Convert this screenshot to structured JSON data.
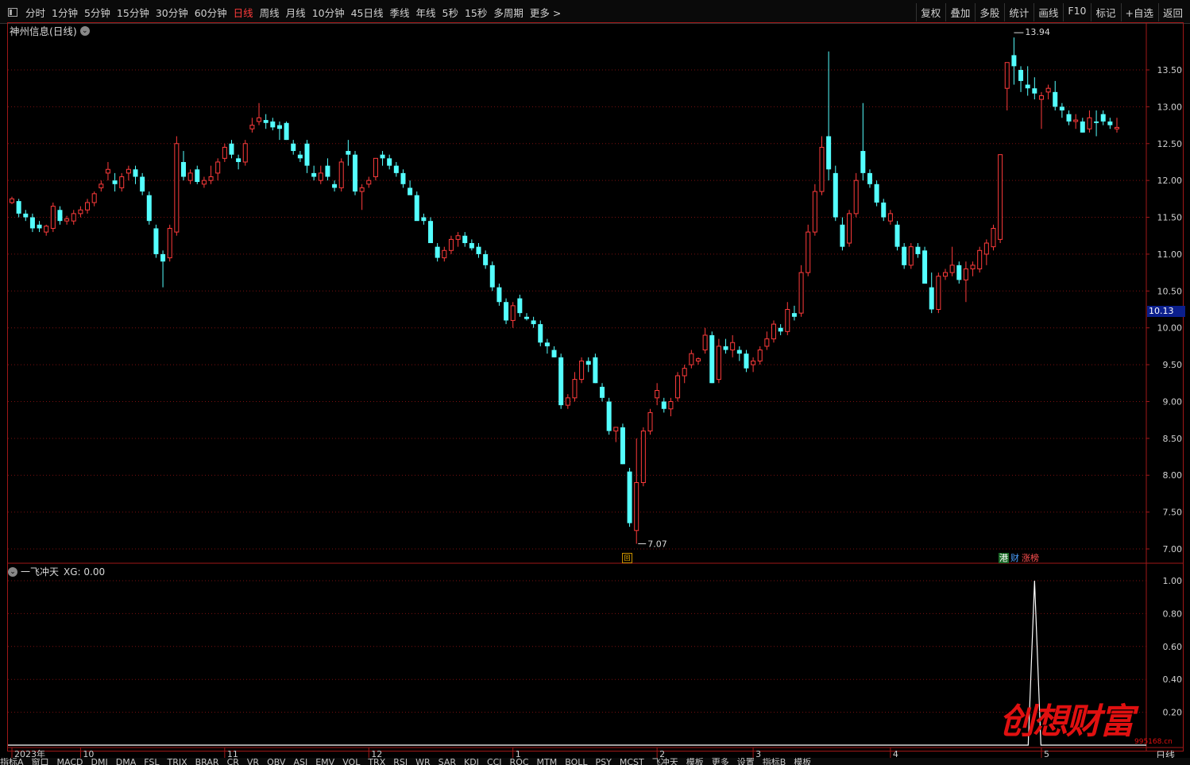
{
  "toolbar": {
    "periods": [
      "分时",
      "1分钟",
      "5分钟",
      "15分钟",
      "30分钟",
      "60分钟",
      "日线",
      "周线",
      "月线",
      "10分钟",
      "45日线",
      "季线",
      "年线",
      "5秒",
      "15秒",
      "多周期",
      "更多 >"
    ],
    "active_period": "日线",
    "right_buttons": [
      "复权",
      "叠加",
      "多股",
      "统计",
      "画线",
      "F10",
      "标记",
      "+自选",
      "返回"
    ]
  },
  "chart": {
    "title": "神州信息(日线)",
    "high_label": "13.94",
    "low_label": "7.07",
    "current_price": "10.13",
    "price_axis": [
      "13.50",
      "13.00",
      "12.50",
      "12.00",
      "11.50",
      "11.00",
      "10.50",
      "10.00",
      "9.50",
      "9.00",
      "8.50",
      "8.00",
      "7.50",
      "7.00"
    ],
    "date_axis": [
      "2023年",
      "10",
      "11",
      "12",
      "1",
      "2",
      "3",
      "4",
      "5"
    ],
    "tags": {
      "hk": "港",
      "cai": "财",
      "zhangbang": "涨榜",
      "event": "回"
    }
  },
  "indicator": {
    "name": "一飞冲天",
    "value_label": "XG: 0.00",
    "axis": [
      "1.00",
      "0.80",
      "0.60",
      "0.40",
      "0.20"
    ]
  },
  "colors": {
    "up": "#ff3b3b",
    "down": "#54ffff",
    "grid": "#7a1010",
    "frame": "#a01818",
    "signal": "#ffffff"
  },
  "bottom_tabs": [
    "指标A",
    "窗口",
    "MACD",
    "DMI",
    "DMA",
    "FSL",
    "TRIX",
    "BRAR",
    "CR",
    "VR",
    "OBV",
    "ASI",
    "EMV",
    "VOL",
    "TRX",
    "RSI",
    "WR",
    "SAR",
    "KDJ",
    "CCI",
    "ROC",
    "MTM",
    "BOLL",
    "PSY",
    "MCST",
    "飞冲天",
    "模板",
    "更多",
    "设置",
    "指标B",
    "模板"
  ],
  "timeframe_corner": "日线",
  "watermark": {
    "text": "创想财富",
    "url": "995168.cn"
  },
  "chart_data": {
    "type": "candlestick",
    "ylim": [
      6.95,
      14.1
    ],
    "candles": [
      [
        11.7,
        11.78,
        11.68,
        11.75
      ],
      [
        11.72,
        11.75,
        11.5,
        11.55
      ],
      [
        11.55,
        11.6,
        11.45,
        11.5
      ],
      [
        11.5,
        11.55,
        11.3,
        11.35
      ],
      [
        11.4,
        11.45,
        11.3,
        11.35
      ],
      [
        11.3,
        11.4,
        11.25,
        11.38
      ],
      [
        11.35,
        11.7,
        11.3,
        11.65
      ],
      [
        11.6,
        11.65,
        11.4,
        11.45
      ],
      [
        11.45,
        11.52,
        11.4,
        11.48
      ],
      [
        11.45,
        11.6,
        11.4,
        11.55
      ],
      [
        11.55,
        11.65,
        11.5,
        11.6
      ],
      [
        11.6,
        11.75,
        11.55,
        11.7
      ],
      [
        11.7,
        11.85,
        11.65,
        11.82
      ],
      [
        11.9,
        12.0,
        11.85,
        11.95
      ],
      [
        12.1,
        12.25,
        12.0,
        12.15
      ],
      [
        12.0,
        12.1,
        11.85,
        11.95
      ],
      [
        11.9,
        12.1,
        11.85,
        12.05
      ],
      [
        12.1,
        12.2,
        12.0,
        12.15
      ],
      [
        12.15,
        12.2,
        11.95,
        12.05
      ],
      [
        12.05,
        12.1,
        11.8,
        11.85
      ],
      [
        11.8,
        11.85,
        11.4,
        11.45
      ],
      [
        11.35,
        11.4,
        10.95,
        11.0
      ],
      [
        11.0,
        11.05,
        10.55,
        10.9
      ],
      [
        10.95,
        11.4,
        10.9,
        11.35
      ],
      [
        11.3,
        12.6,
        11.25,
        12.5
      ],
      [
        12.25,
        12.4,
        12.0,
        12.05
      ],
      [
        12.0,
        12.15,
        11.95,
        12.1
      ],
      [
        12.15,
        12.2,
        11.95,
        11.98
      ],
      [
        11.95,
        12.05,
        11.9,
        12.0
      ],
      [
        12.0,
        12.2,
        11.95,
        12.05
      ],
      [
        12.1,
        12.3,
        12.0,
        12.25
      ],
      [
        12.3,
        12.5,
        12.25,
        12.45
      ],
      [
        12.5,
        12.55,
        12.3,
        12.35
      ],
      [
        12.3,
        12.35,
        12.15,
        12.25
      ],
      [
        12.25,
        12.55,
        12.2,
        12.5
      ],
      [
        12.7,
        12.85,
        12.65,
        12.75
      ],
      [
        12.8,
        13.05,
        12.75,
        12.85
      ],
      [
        12.82,
        12.9,
        12.7,
        12.78
      ],
      [
        12.8,
        12.85,
        12.68,
        12.72
      ],
      [
        12.75,
        12.8,
        12.55,
        12.7
      ],
      [
        12.78,
        12.8,
        12.55,
        12.55
      ],
      [
        12.5,
        12.55,
        12.35,
        12.4
      ],
      [
        12.35,
        12.4,
        12.25,
        12.3
      ],
      [
        12.5,
        12.55,
        12.1,
        12.2
      ],
      [
        12.1,
        12.2,
        12.0,
        12.05
      ],
      [
        12.0,
        12.2,
        11.95,
        12.1
      ],
      [
        12.2,
        12.3,
        12.0,
        12.05
      ],
      [
        11.95,
        12.0,
        11.85,
        11.9
      ],
      [
        11.9,
        12.3,
        11.85,
        12.25
      ],
      [
        12.4,
        12.55,
        12.2,
        12.35
      ],
      [
        12.35,
        12.4,
        11.8,
        11.85
      ],
      [
        11.85,
        11.95,
        11.6,
        11.9
      ],
      [
        11.95,
        12.05,
        11.9,
        12.0
      ],
      [
        12.05,
        12.2,
        12.0,
        12.3
      ],
      [
        12.35,
        12.4,
        12.2,
        12.3
      ],
      [
        12.3,
        12.35,
        12.15,
        12.2
      ],
      [
        12.2,
        12.25,
        12.05,
        12.1
      ],
      [
        12.1,
        12.15,
        11.9,
        11.95
      ],
      [
        11.9,
        12.0,
        11.85,
        11.8
      ],
      [
        11.8,
        11.85,
        11.5,
        11.45
      ],
      [
        11.5,
        11.55,
        11.4,
        11.45
      ],
      [
        11.45,
        11.5,
        11.15,
        11.15
      ],
      [
        11.1,
        11.15,
        10.9,
        10.95
      ],
      [
        10.95,
        11.1,
        10.9,
        11.05
      ],
      [
        11.05,
        11.25,
        11.0,
        11.2
      ],
      [
        11.2,
        11.3,
        11.1,
        11.25
      ],
      [
        11.25,
        11.3,
        11.1,
        11.15
      ],
      [
        11.15,
        11.2,
        11.05,
        11.08
      ],
      [
        11.1,
        11.15,
        10.95,
        11.0
      ],
      [
        11.0,
        11.05,
        10.8,
        10.85
      ],
      [
        10.85,
        10.9,
        10.5,
        10.55
      ],
      [
        10.55,
        10.6,
        10.3,
        10.35
      ],
      [
        10.35,
        10.4,
        10.05,
        10.1
      ],
      [
        10.1,
        10.35,
        10.0,
        10.3
      ],
      [
        10.4,
        10.45,
        10.15,
        10.2
      ],
      [
        10.15,
        10.2,
        10.1,
        10.12
      ],
      [
        10.1,
        10.15,
        10.0,
        10.05
      ],
      [
        10.05,
        10.1,
        9.75,
        9.8
      ],
      [
        9.8,
        9.85,
        9.65,
        9.75
      ],
      [
        9.7,
        9.75,
        9.6,
        9.6
      ],
      [
        9.6,
        9.65,
        8.9,
        8.95
      ],
      [
        8.95,
        9.1,
        8.9,
        9.05
      ],
      [
        9.05,
        9.4,
        9.0,
        9.3
      ],
      [
        9.3,
        9.6,
        9.25,
        9.55
      ],
      [
        9.55,
        9.6,
        9.4,
        9.5
      ],
      [
        9.6,
        9.65,
        9.25,
        9.25
      ],
      [
        9.2,
        9.25,
        9.0,
        9.05
      ],
      [
        9.0,
        9.05,
        8.55,
        8.6
      ],
      [
        8.6,
        8.65,
        8.45,
        8.65
      ],
      [
        8.65,
        8.7,
        8.15,
        8.15
      ],
      [
        8.05,
        8.1,
        7.3,
        7.35
      ],
      [
        7.25,
        8.5,
        7.07,
        7.9
      ],
      [
        7.9,
        8.65,
        7.85,
        8.6
      ],
      [
        8.6,
        8.9,
        8.55,
        8.85
      ],
      [
        9.05,
        9.25,
        8.95,
        9.15
      ],
      [
        9.0,
        9.05,
        8.85,
        8.9
      ],
      [
        8.9,
        9.05,
        8.8,
        9.0
      ],
      [
        9.05,
        9.4,
        9.0,
        9.35
      ],
      [
        9.35,
        9.5,
        9.25,
        9.45
      ],
      [
        9.5,
        9.7,
        9.45,
        9.65
      ],
      [
        9.55,
        9.6,
        9.5,
        9.58
      ],
      [
        9.7,
        10.0,
        9.65,
        9.9
      ],
      [
        9.9,
        9.95,
        9.25,
        9.25
      ],
      [
        9.3,
        9.85,
        9.25,
        9.75
      ],
      [
        9.75,
        9.85,
        9.65,
        9.7
      ],
      [
        9.7,
        9.9,
        9.6,
        9.8
      ],
      [
        9.7,
        9.75,
        9.55,
        9.65
      ],
      [
        9.65,
        9.7,
        9.4,
        9.45
      ],
      [
        9.5,
        9.6,
        9.4,
        9.55
      ],
      [
        9.55,
        9.75,
        9.5,
        9.7
      ],
      [
        9.75,
        9.95,
        9.7,
        9.85
      ],
      [
        9.85,
        10.1,
        9.8,
        10.05
      ],
      [
        10.0,
        10.05,
        9.9,
        9.95
      ],
      [
        9.95,
        10.35,
        9.9,
        10.25
      ],
      [
        10.2,
        10.3,
        10.1,
        10.15
      ],
      [
        10.2,
        10.85,
        10.15,
        10.75
      ],
      [
        10.75,
        11.4,
        10.7,
        11.3
      ],
      [
        11.3,
        11.95,
        11.25,
        11.85
      ],
      [
        11.85,
        12.6,
        11.8,
        12.45
      ],
      [
        12.6,
        13.75,
        12.0,
        12.15
      ],
      [
        12.1,
        12.2,
        11.45,
        11.5
      ],
      [
        11.4,
        11.5,
        11.05,
        11.1
      ],
      [
        11.15,
        11.6,
        11.1,
        11.55
      ],
      [
        11.55,
        12.1,
        11.5,
        12.0
      ],
      [
        12.4,
        13.05,
        12.0,
        12.1
      ],
      [
        12.1,
        12.15,
        11.9,
        11.95
      ],
      [
        11.95,
        12.0,
        11.65,
        11.7
      ],
      [
        11.7,
        11.75,
        11.45,
        11.5
      ],
      [
        11.45,
        11.6,
        11.4,
        11.55
      ],
      [
        11.4,
        11.45,
        11.05,
        11.1
      ],
      [
        11.1,
        11.15,
        10.8,
        10.85
      ],
      [
        10.85,
        11.15,
        10.8,
        11.1
      ],
      [
        11.1,
        11.15,
        10.95,
        11.0
      ],
      [
        11.05,
        11.1,
        10.6,
        10.6
      ],
      [
        10.55,
        10.75,
        10.2,
        10.25
      ],
      [
        10.25,
        10.75,
        10.2,
        10.7
      ],
      [
        10.7,
        10.8,
        10.65,
        10.75
      ],
      [
        10.75,
        11.1,
        10.7,
        10.85
      ],
      [
        10.85,
        10.9,
        10.6,
        10.65
      ],
      [
        10.65,
        10.9,
        10.35,
        10.8
      ],
      [
        10.8,
        10.9,
        10.7,
        10.85
      ],
      [
        10.8,
        11.1,
        10.75,
        11.05
      ],
      [
        11.0,
        11.2,
        10.85,
        11.15
      ],
      [
        11.1,
        11.4,
        11.05,
        11.35
      ],
      [
        11.2,
        12.35,
        11.15,
        12.35
      ],
      [
        13.25,
        13.6,
        12.95,
        13.6
      ],
      [
        13.7,
        13.94,
        13.3,
        13.55
      ],
      [
        13.5,
        13.55,
        13.2,
        13.35
      ],
      [
        13.3,
        13.55,
        13.15,
        13.25
      ],
      [
        13.25,
        13.4,
        13.1,
        13.18
      ],
      [
        13.1,
        13.2,
        12.7,
        13.15
      ],
      [
        13.2,
        13.3,
        13.1,
        13.25
      ],
      [
        13.2,
        13.35,
        12.95,
        13.0
      ],
      [
        13.0,
        13.05,
        12.85,
        12.95
      ],
      [
        12.9,
        12.95,
        12.75,
        12.8
      ],
      [
        12.8,
        12.9,
        12.7,
        12.82
      ],
      [
        12.8,
        12.85,
        12.65,
        12.65
      ],
      [
        12.7,
        12.95,
        12.65,
        12.85
      ],
      [
        12.8,
        12.95,
        12.6,
        12.78
      ],
      [
        12.9,
        12.95,
        12.75,
        12.8
      ],
      [
        12.8,
        12.85,
        12.7,
        12.75
      ],
      [
        12.7,
        12.85,
        12.65,
        12.72
      ]
    ],
    "indicator_signal_index": 149,
    "indicator_series": "XG"
  }
}
